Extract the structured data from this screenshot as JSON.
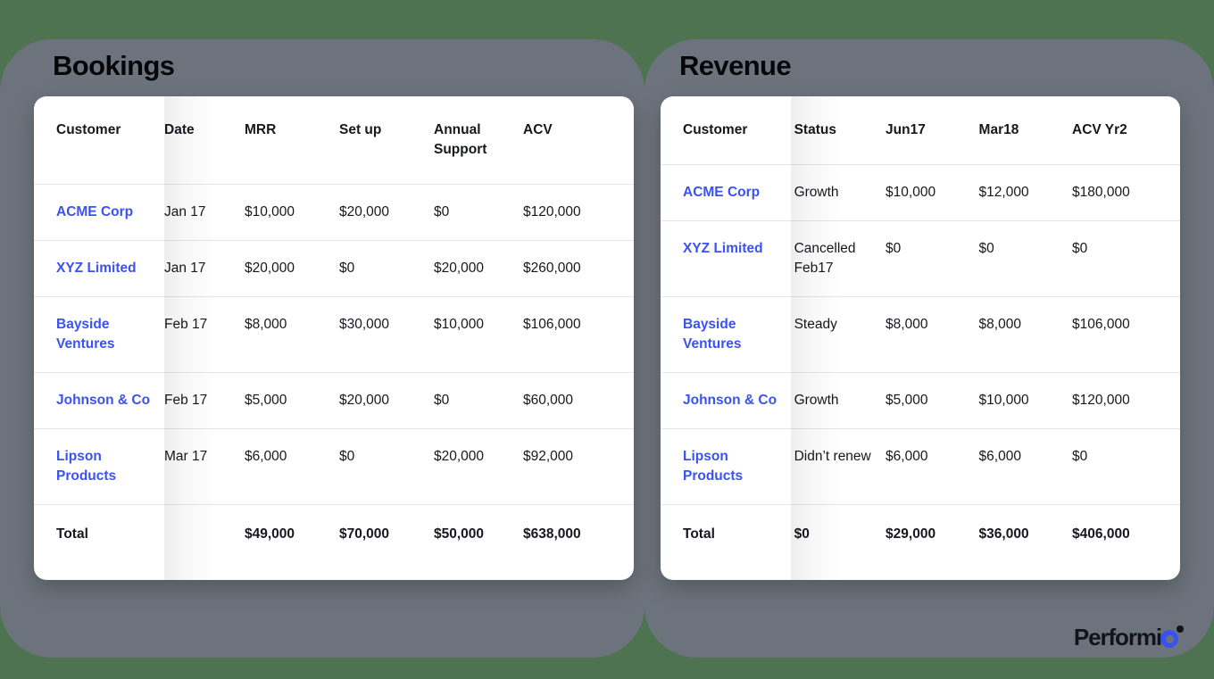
{
  "theme": {
    "background_color": "#4d7350",
    "panel_color": "#6d737c",
    "card_color": "#ffffff",
    "accent_color": "#3b52f2",
    "text_color": "#16181d",
    "rule_color": "#e4e6ea"
  },
  "sections": {
    "bookings": {
      "title": "Bookings",
      "table": {
        "columns": [
          "Customer",
          "Date",
          "MRR",
          "Set up",
          "Annual Support",
          "ACV"
        ],
        "rows": [
          {
            "customer": "ACME Corp",
            "date": "Jan 17",
            "mrr": "$10,000",
            "setup": "$20,000",
            "support": "$0",
            "acv": "$120,000"
          },
          {
            "customer": "XYZ Limited",
            "date": "Jan 17",
            "mrr": "$20,000",
            "setup": "$0",
            "support": "$20,000",
            "acv": "$260,000"
          },
          {
            "customer": "Bayside Ventures",
            "date": "Feb 17",
            "mrr": "$8,000",
            "setup": "$30,000",
            "support": "$10,000",
            "acv": "$106,000"
          },
          {
            "customer": "Johnson & Co",
            "date": "Feb 17",
            "mrr": "$5,000",
            "setup": "$20,000",
            "support": "$0",
            "acv": "$60,000"
          },
          {
            "customer": "Lipson Products",
            "date": "Mar 17",
            "mrr": "$6,000",
            "setup": "$0",
            "support": "$20,000",
            "acv": "$92,000"
          }
        ],
        "total": {
          "customer": "Total",
          "date": "",
          "mrr": "$49,000",
          "setup": "$70,000",
          "support": "$50,000",
          "acv": "$638,000"
        }
      }
    },
    "revenue": {
      "title": "Revenue",
      "table": {
        "columns": [
          "Customer",
          "Status",
          "Jun17",
          "Mar18",
          "ACV Yr2"
        ],
        "rows": [
          {
            "customer": "ACME Corp",
            "status": "Growth",
            "p1": "$10,000",
            "p2": "$12,000",
            "p3": "$180,000"
          },
          {
            "customer": "XYZ Limited",
            "status": "Cancelled Feb17",
            "p1": "$0",
            "p2": "$0",
            "p3": "$0"
          },
          {
            "customer": "Bayside Ventures",
            "status": "Steady",
            "p1": "$8,000",
            "p2": "$8,000",
            "p3": "$106,000"
          },
          {
            "customer": "Johnson & Co",
            "status": "Growth",
            "p1": "$5,000",
            "p2": "$10,000",
            "p3": "$120,000"
          },
          {
            "customer": "Lipson Products",
            "status": "Didn’t renew",
            "p1": "$6,000",
            "p2": "$6,000",
            "p3": "$0"
          }
        ],
        "total": {
          "customer": "Total",
          "status": "$0",
          "p1": "$29,000",
          "p2": "$36,000",
          "p3": "$406,000"
        }
      }
    }
  },
  "logo": {
    "wordmark": "Performi",
    "mark_name": "performio-o-mark"
  }
}
